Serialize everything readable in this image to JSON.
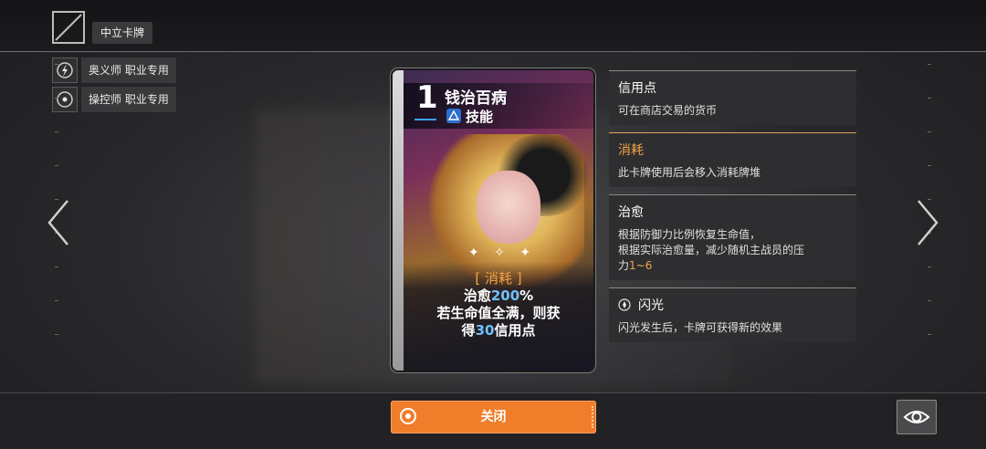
{
  "header": {
    "tag_label": "中立卡牌",
    "class_tags": [
      {
        "label": "奥义师 职业专用",
        "icon": "lightning-icon"
      },
      {
        "label": "操控师 职业专用",
        "icon": "target-icon"
      }
    ]
  },
  "card": {
    "cost": "1",
    "name": "钱治百病",
    "type": "技能",
    "desc": {
      "keyword": "[ 消耗 ]",
      "line1_prefix": "治愈",
      "line1_value": "200",
      "line1_suffix": "%",
      "line2": "若生命值全满，则获",
      "line3_prefix": "得",
      "line3_value": "30",
      "line3_suffix": "信用点"
    }
  },
  "info": [
    {
      "title": "信用点",
      "body": "可在商店交易的货币"
    },
    {
      "title": "消耗",
      "body": "此卡牌使用后会移入消耗牌堆"
    },
    {
      "title": "治愈",
      "body_line1": "根据防御力比例恢复生命值，",
      "body_line2": "根据实际治愈量，减少随机主战员的压",
      "body_line3_prefix": "力",
      "body_line3_value": "1~6"
    },
    {
      "title": "闪光",
      "body": "闪光发生后，卡牌可获得新的效果",
      "icon": "flash-icon"
    }
  ],
  "footer": {
    "close_label": "关闭",
    "eye_icon": "eye-icon"
  },
  "colors": {
    "accent_orange": "#f07d2a",
    "keyword_orange": "#f4a346",
    "value_blue": "#6fc0ff"
  }
}
